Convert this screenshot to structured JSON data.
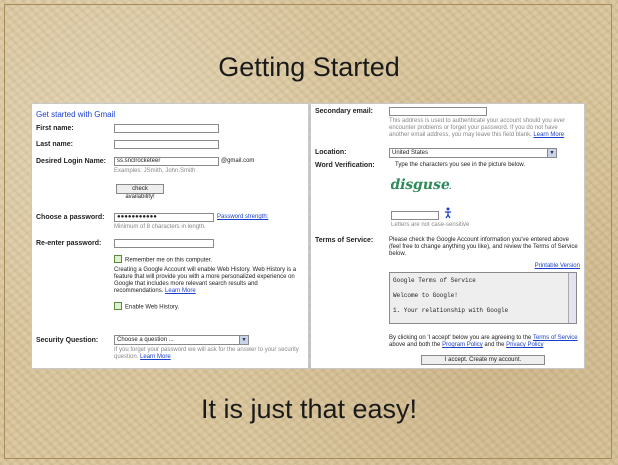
{
  "slide": {
    "title": "Getting Started",
    "footer": "It is just that easy!"
  },
  "left_form": {
    "heading": "Get started with Gmail",
    "first_name_label": "First name:",
    "last_name_label": "Last name:",
    "login_label": "Desired Login Name:",
    "login_value": "ss.snclrocketeer",
    "domain_suffix": "@gmail.com",
    "login_examples": "Examples: JSmith, John.Smith",
    "check_button": "check availability!",
    "password_label": "Choose a password:",
    "password_value": "●●●●●●●●●●●",
    "password_strength": "Password strength:",
    "password_hint": "Minimum of 8 characters in length.",
    "reenter_label": "Re-enter password:",
    "remember_label": "Remember me on this computer.",
    "web_history_text": "Creating a Google Account will enable Web History. Web History is a feature that will provide you with a more personalized experience on Google that includes more relevant search results and recommendations.",
    "learn_more": "Learn More",
    "enable_web_history": "Enable Web History.",
    "security_label": "Security Question:",
    "security_value": "Choose a question ...",
    "security_hint": "If you forget your password we will ask for the answer to your security question.",
    "security_learn_more": "Learn More"
  },
  "right_form": {
    "secondary_email_label": "Secondary email:",
    "secondary_email_hint": "This address is used to authenticate your account should you ever encounter problems or forget your password. If you do not have another email address, you may leave this field blank.",
    "secondary_learn_more": "Learn More",
    "location_label": "Location:",
    "location_value": "United States",
    "word_verification_label": "Word Verification:",
    "word_verification_prompt": "Type the characters you see in the picture below.",
    "captcha_text": "disgusem",
    "case_hint": "Letters are not case-sensitive",
    "tos_label": "Terms of Service:",
    "tos_intro": "Please check the Google Account information you've entered above (feel free to change anything you like), and review the Terms of Service below.",
    "printable_version": "Printable Version",
    "tos_lines": [
      "Google Terms of Service",
      "Welcome to Google!",
      "1. Your relationship with Google"
    ],
    "agree_text_1": "By clicking on 'I accept' below you are agreeing to the",
    "terms_link": "Terms of Service",
    "agree_text_2": "above and both the",
    "program_policy": "Program Policy",
    "and_the": "and the",
    "privacy_policy": "Privacy Policy",
    "accept_button": "I accept. Create my account."
  },
  "colors": {
    "link": "#1a3ecc",
    "background": "#d8c49a"
  }
}
